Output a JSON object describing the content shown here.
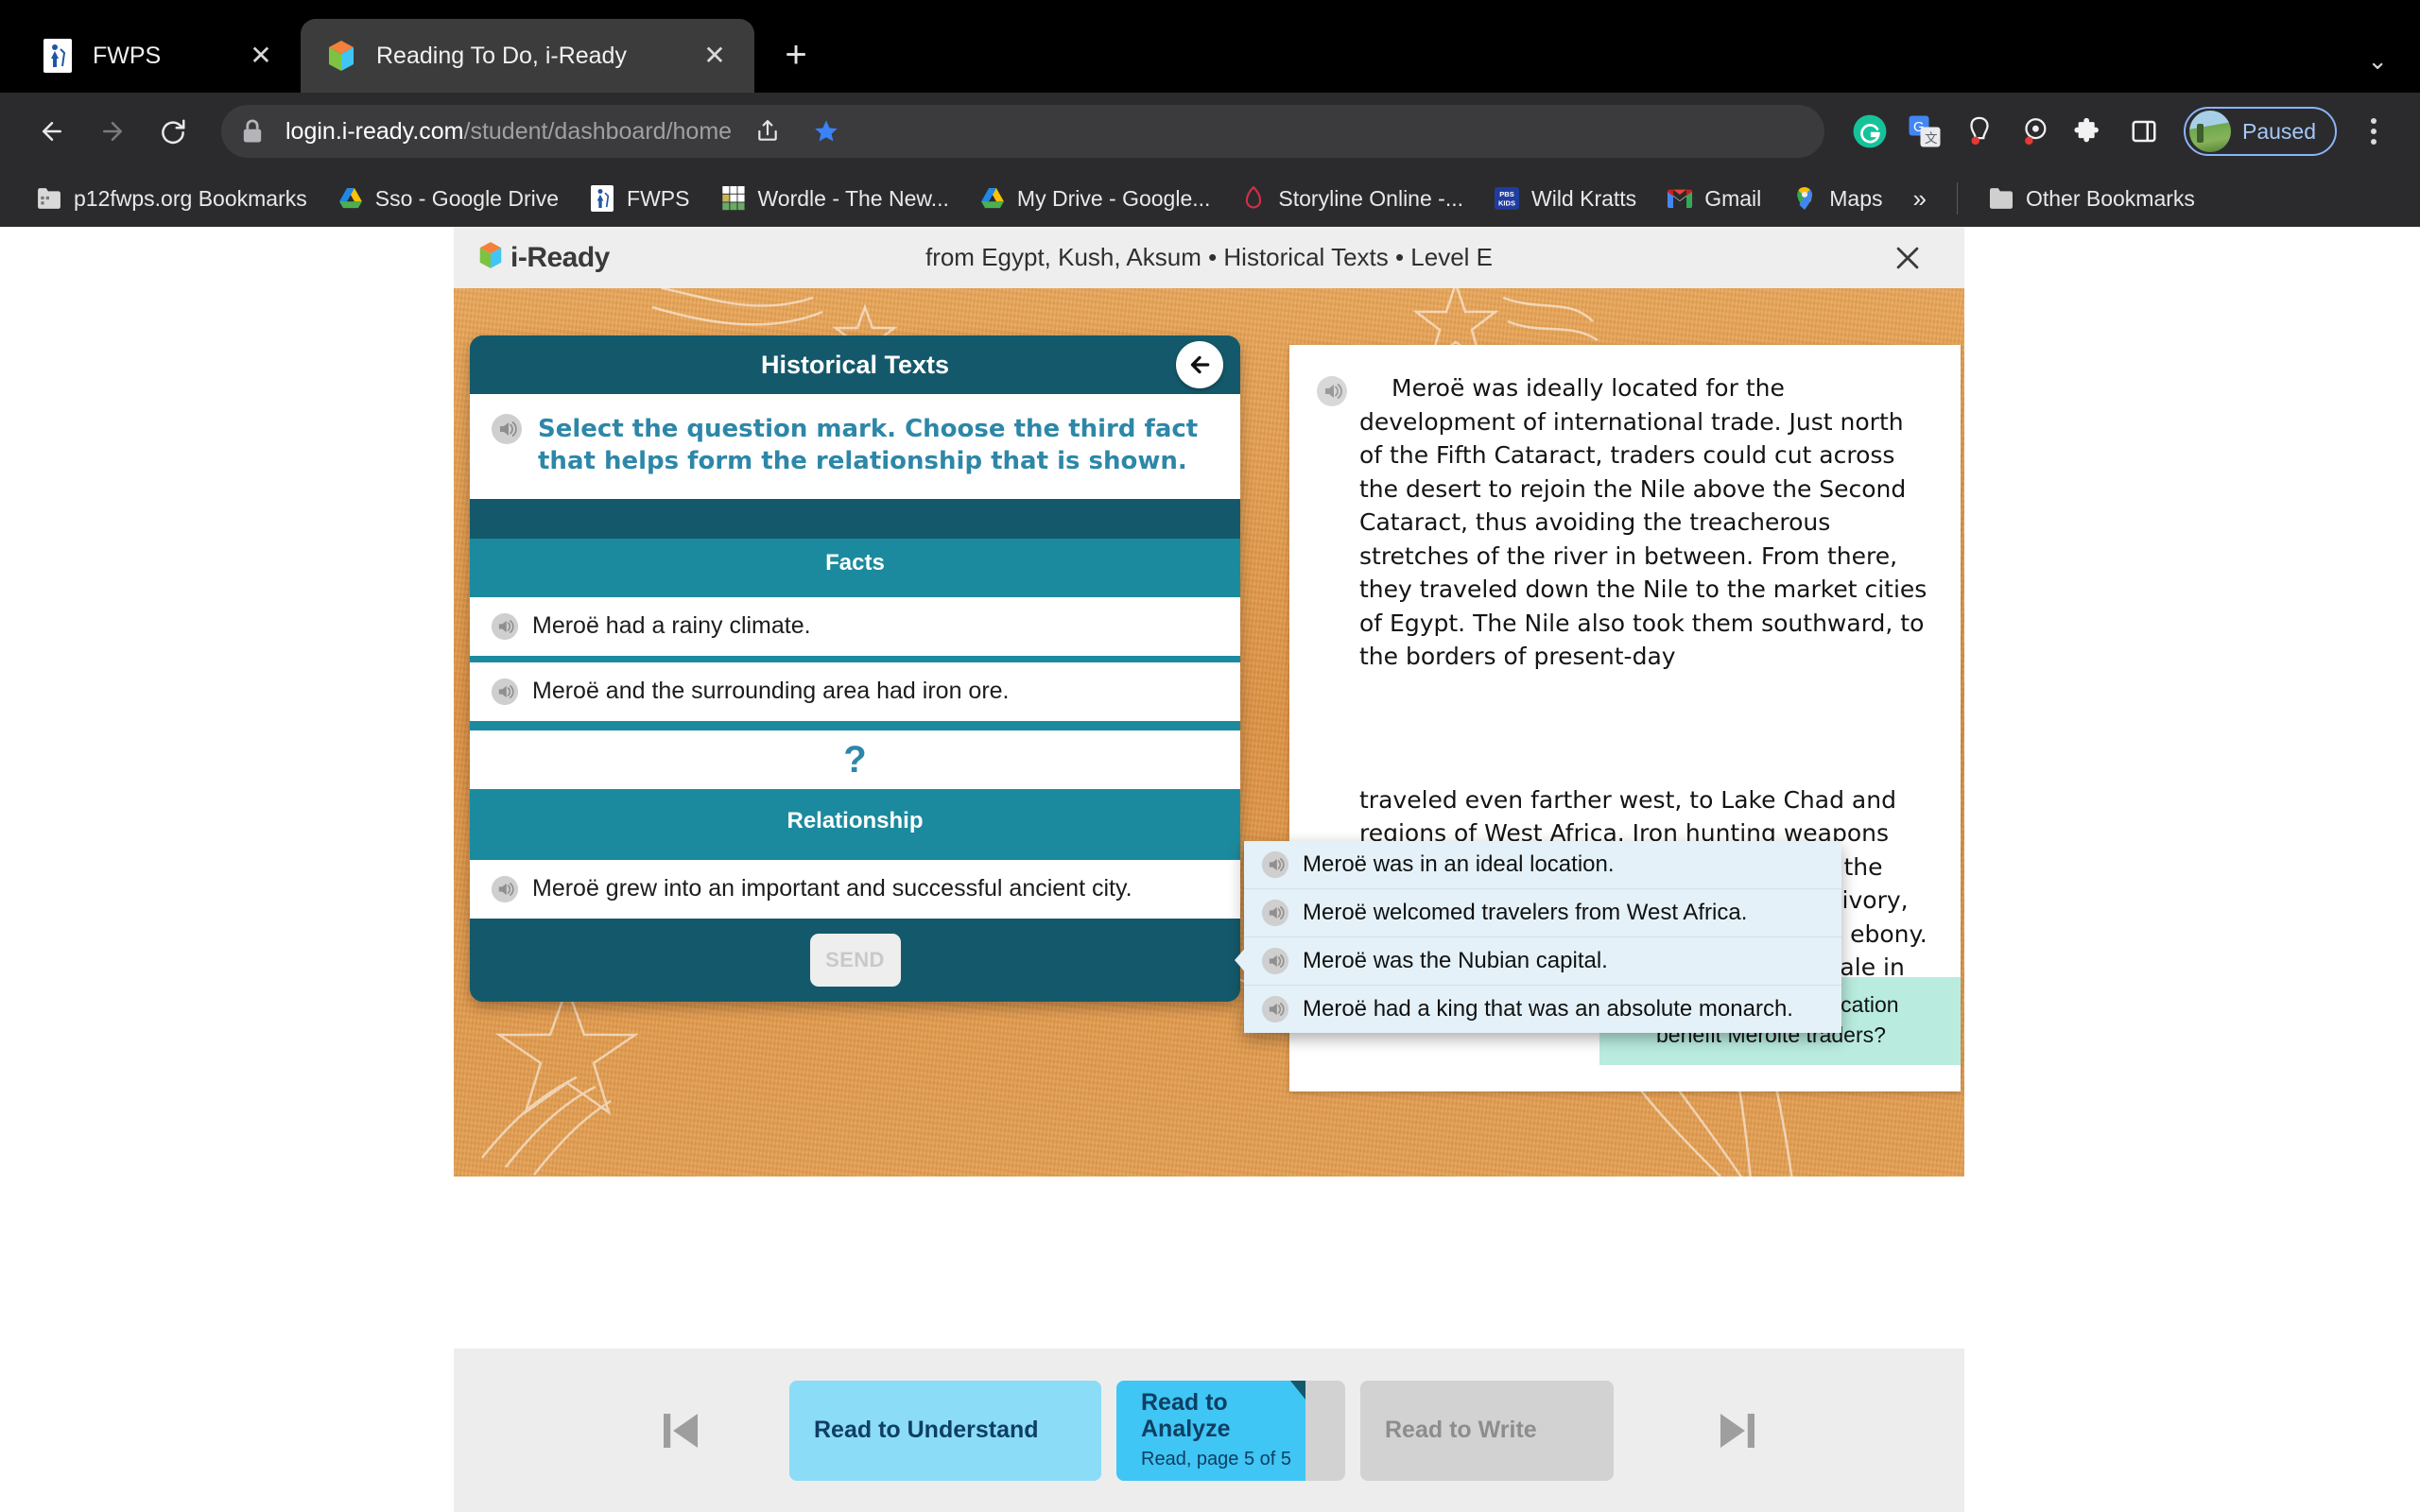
{
  "browser": {
    "tabs": [
      {
        "title": "FWPS",
        "favicon": "fwps-logo-icon",
        "active": false,
        "close_label": "✕"
      },
      {
        "title": "Reading To Do, i-Ready",
        "favicon": "iready-book-icon",
        "active": true,
        "close_label": "✕"
      }
    ],
    "new_tab_label": "+",
    "tab_list_chevron": "⌄",
    "address": {
      "scheme_icon": "lock-icon",
      "host": "login.i-ready.com",
      "path": "/student/dashboard/home"
    },
    "toolbar_icons": [
      "share-icon",
      "bookmark-star-icon",
      "grammarly-icon",
      "google-translate-icon",
      "extension-red-icon",
      "extension-target-icon",
      "puzzle-extensions-icon",
      "side-panel-icon"
    ],
    "profile": {
      "label": "Paused",
      "avatar": "profile-avatar"
    },
    "menu_icon": "kebab-menu-icon",
    "bookmarks": [
      {
        "label": "p12fwps.org Bookmarks",
        "icon": "folder-bookmarks-icon"
      },
      {
        "label": "Sso - Google Drive",
        "icon": "google-drive-icon"
      },
      {
        "label": "FWPS",
        "icon": "fwps-logo-icon"
      },
      {
        "label": "Wordle - The New...",
        "icon": "wordle-grid-icon"
      },
      {
        "label": "My Drive - Google...",
        "icon": "google-drive-icon"
      },
      {
        "label": "Storyline Online -...",
        "icon": "storyline-icon"
      },
      {
        "label": "Wild Kratts",
        "icon": "pbs-kids-icon"
      },
      {
        "label": "Gmail",
        "icon": "gmail-icon"
      },
      {
        "label": "Maps",
        "icon": "google-maps-icon"
      }
    ],
    "bookmarks_overflow": "»",
    "other_bookmarks": {
      "label": "Other Bookmarks",
      "icon": "folder-icon"
    }
  },
  "app": {
    "logo_text": "i-Ready",
    "logo_icon": "iready-book-icon",
    "title": "from Egypt, Kush, Aksum • Historical Texts • Level E",
    "close_label": "✕",
    "activity": {
      "card_title": "Historical Texts",
      "back_icon": "back-arrow-icon",
      "prompt": "Select the question mark. Choose the third fact that helps form the relationship that is shown.",
      "prompt_audio_icon": "speaker-icon",
      "facts_heading": "Facts",
      "facts": [
        {
          "text": "Meroë had a rainy climate.",
          "audio_icon": "speaker-icon"
        },
        {
          "text": "Meroë and the surrounding area had iron ore.",
          "audio_icon": "speaker-icon"
        }
      ],
      "question_mark": "?",
      "relationship_heading": "Relationship",
      "relationship": {
        "text": "Meroë grew into an important and successful ancient city.",
        "audio_icon": "speaker-icon"
      },
      "send_label": "SEND"
    },
    "choices": {
      "audio_icon": "speaker-icon",
      "items": [
        "Meroë was in an ideal location.",
        "Meroë welcomed travelers from West Africa.",
        "Meroë was the Nubian capital.",
        "Meroë had a king that was an absolute monarch."
      ]
    },
    "passage": {
      "audio_icon": "speaker-icon",
      "paragraph_top": "Meroë was ideally located for the development of international trade. Just north of the Fifth Cataract, traders could cut across the desert to rejoin the Nile above the Second Cataract, thus avoiding the treacherous stretches of the river in between. From there, they traveled down the Nile to the market cities of Egypt. The Nile also took them southward, to the borders of present-day",
      "paragraph_bottom": "traveled even farther west, to Lake Chad and regions of West Africa. Iron hunting weapons and tools for mining and farming helped the Meroites to provide trade goods such as ivory, leopard skins, ostrich feathers, gold, and ebony. They also supplied iron implements for sale in distant markets.",
      "question_callout": {
        "text": "How did Meroë’s location benefit Meroitë traders?",
        "audio_icon": "speaker-icon"
      }
    },
    "bottom_nav": {
      "prev_icon": "skip-previous-icon",
      "next_icon": "skip-next-icon",
      "stages": [
        {
          "label": "Read to Understand",
          "sub": "",
          "state": "completed"
        },
        {
          "label": "Read to Analyze",
          "sub": "Read, page 5 of 5",
          "state": "current"
        },
        {
          "label": "Read to Write",
          "sub": "",
          "state": "locked"
        }
      ]
    }
  },
  "colors": {
    "teal_dark": "#14596b",
    "teal_mid": "#1c8a9e",
    "prompt_blue": "#2d87a8",
    "cork_orange": "#e09a4e",
    "choice_bg": "#e4f1f8",
    "callout_green": "#b9ecdf",
    "stage_completed": "#8bdcf7",
    "stage_current": "#3fc6f4",
    "stage_locked": "#d2d2d2"
  }
}
